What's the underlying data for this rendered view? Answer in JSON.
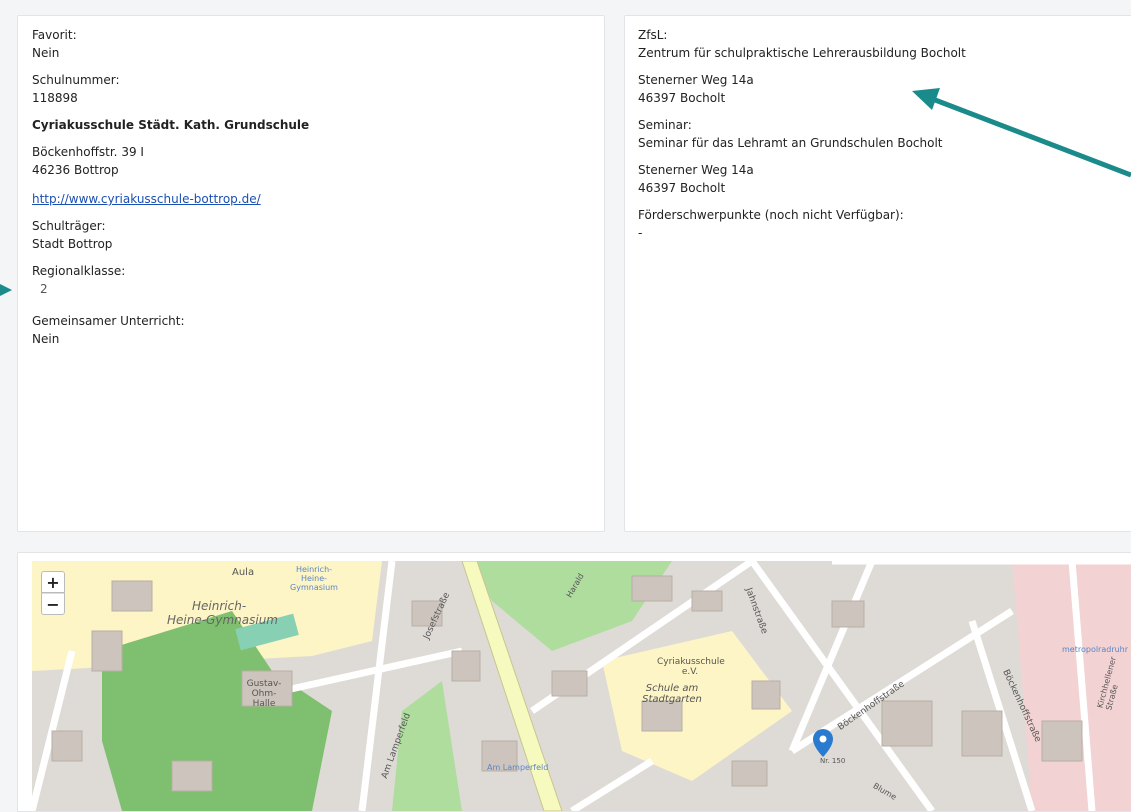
{
  "left": {
    "favorite_label": "Favorit:",
    "favorite_value": "Nein",
    "school_number_label": "Schulnummer:",
    "school_number_value": "118898",
    "school_name": "Cyriakusschule Städt. Kath. Grundschule",
    "street": "Böckenhoffstr. 39 I",
    "city": "46236 Bottrop",
    "website": "http://www.cyriakusschule-bottrop.de/",
    "carrier_label": "Schulträger:",
    "carrier_value": "Stadt Bottrop",
    "region_label": "Regionalklasse:",
    "region_value": "2",
    "joint_label": "Gemeinsamer Unterricht:",
    "joint_value": "Nein"
  },
  "right": {
    "zfsl_label": "ZfsL:",
    "zfsl_value": "Zentrum für schulpraktische Lehrerausbildung Bocholt",
    "zfsl_street": "Stenerner Weg 14a",
    "zfsl_city": "46397 Bocholt",
    "seminar_label": "Seminar:",
    "seminar_value": "Seminar für das Lehramt an Grundschulen Bocholt",
    "seminar_street": "Stenerner Weg 14a",
    "seminar_city": "46397 Bocholt",
    "focus_label": "Förderschwerpunkte (noch nicht Verfügbar):",
    "focus_value": "-"
  },
  "map": {
    "zoom_in": "+",
    "zoom_out": "−",
    "labels": {
      "aula": "Aula",
      "heinrich_small": "Heinrich-Heine-Gymnasium",
      "heinrich_big_1": "Heinrich-",
      "heinrich_big_2": "Heine-Gymnasium",
      "gustav": "Gustav-Ohm-Halle",
      "cyriakus": "Cyriakusschule e.V.",
      "schule": "Schule am Stadtgarten",
      "josef": "Josefstraße",
      "jahn": "Jahnstraße",
      "boecken": "Böckenhoffstraße",
      "boecken2": "Böckenhoffstraße",
      "am_lamperfeld": "Am Lamperfeld",
      "am_lamperfeld_stop": "Am Lamperfeld",
      "kirch": "Kirchhellener Straße",
      "metro": "metropolradruhr",
      "nr150": "Nr. 150",
      "harald": "Harald",
      "blume": "Blume"
    },
    "colors": {
      "background": "#dedbd6",
      "school_area": "#fdf5c6",
      "park": "#aedd9e",
      "wood": "#7fbf70",
      "building": "#cdc5bd",
      "road": "#ffffff",
      "main_road": "#f7fabf",
      "commercial": "#f2d2d2",
      "pin": "#2a7bd0",
      "arrow": "#1a8a8a"
    }
  }
}
